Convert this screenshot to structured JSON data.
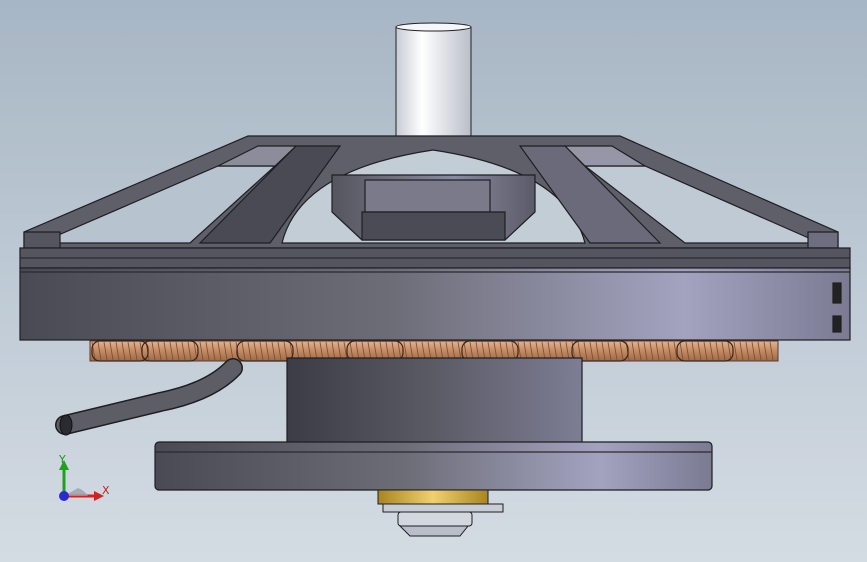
{
  "view": {
    "background_top": "#a7b6c4",
    "background_bottom": "#d4dce3"
  },
  "triad": {
    "x_label": "X",
    "y_label": "Y",
    "x_color": "#d42020",
    "y_color": "#1fa01f",
    "z_color": "#2a2ad0"
  },
  "model": {
    "metal_color": "#6b6b78",
    "copper_color": "#c9906a",
    "shaft_color": "#eef1f5",
    "brass_color": "#c8a030"
  }
}
